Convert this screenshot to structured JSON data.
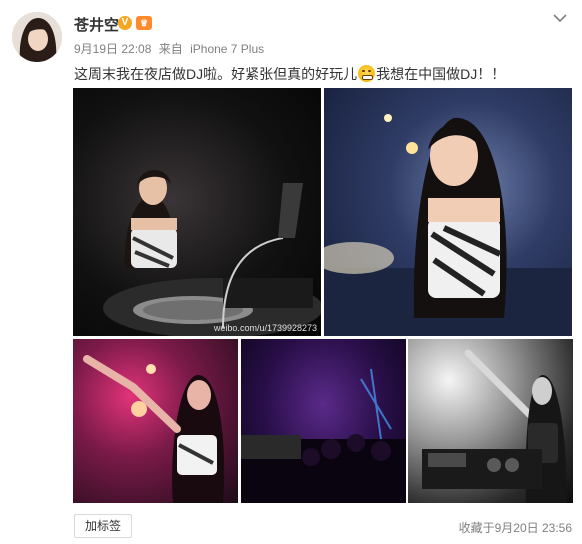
{
  "post": {
    "username": "苍井空",
    "verified_icon": "verified-badge-icon",
    "vip_icon": "vip-icon",
    "date": "9月19日 22:08",
    "source_prefix": "来自",
    "source": "iPhone 7 Plus",
    "text_part1": "这周末我在夜店做DJ啦。好紧张但真的好玩儿",
    "emoji_name": "grin-emoji-icon",
    "text_part2": "我想在中国做DJ！！",
    "watermark": "weibo.com/u/1739928273"
  },
  "footer": {
    "add_tag_label": "加标签",
    "favorited_text": "收藏于9月20日 23:56"
  },
  "colors": {
    "text": "#333333",
    "muted": "#808080",
    "verified": "#f5a623"
  }
}
